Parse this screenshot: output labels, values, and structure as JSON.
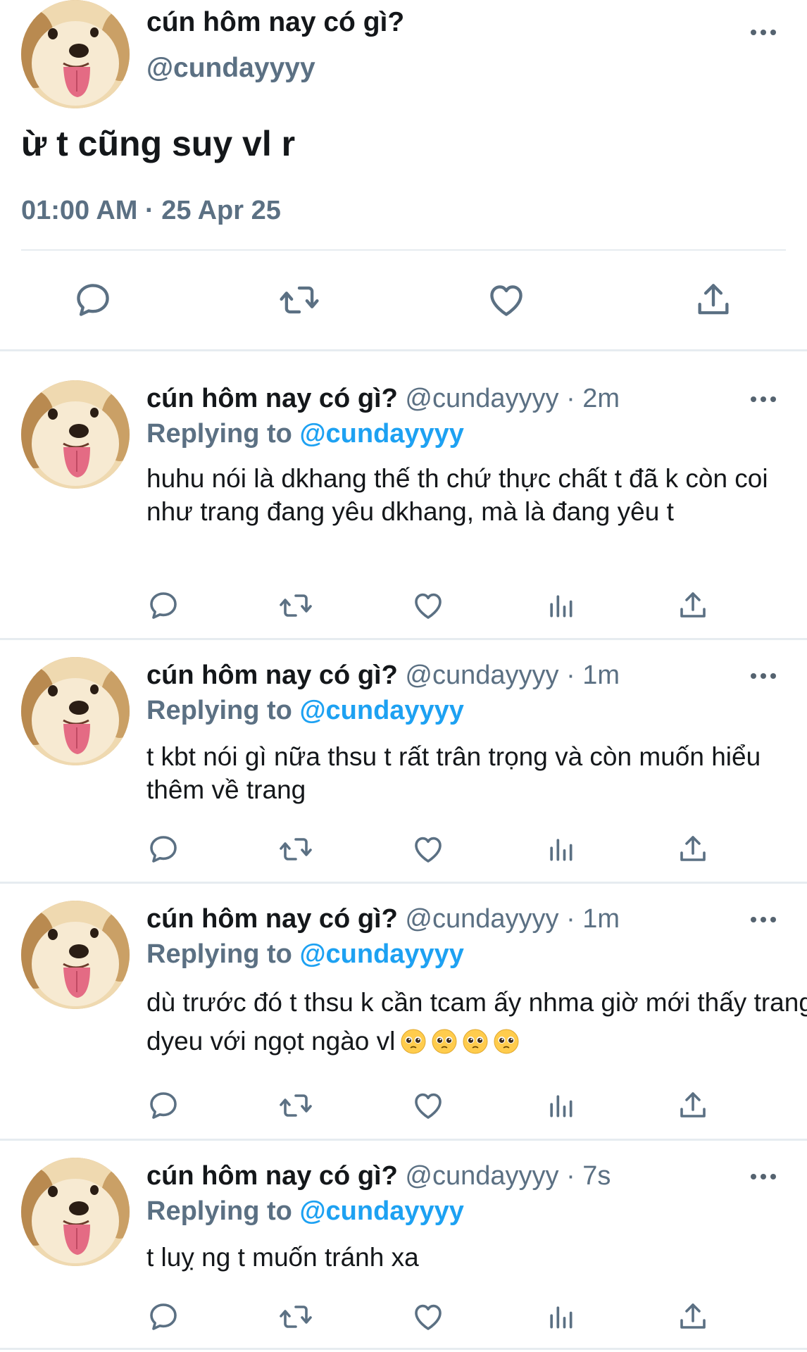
{
  "main_tweet": {
    "display_name": "cún hôm nay có gì?",
    "handle": "@cundayyyy",
    "text": "ừ t cũng suy vl r",
    "timestamp": "01:00 AM · 25 Apr 25",
    "actions": [
      "reply-icon",
      "retweet-icon",
      "like-icon",
      "share-icon"
    ]
  },
  "replies": [
    {
      "display_name": "cún hôm nay có gì?",
      "handle": "@cundayyyy",
      "time": "· 2m",
      "replying_prefix": "Replying to",
      "replying_to": "@cundayyyy",
      "text": "huhu nói là dkhang thế th chứ thực chất t đã k còn coi như trang đang yêu dkhang, mà là đang yêu t"
    },
    {
      "display_name": "cún hôm nay có gì?",
      "handle": "@cundayyyy",
      "time": "· 1m",
      "replying_prefix": "Replying to",
      "replying_to": "@cundayyyy",
      "text": "t kbt nói gì nữa thsu t rất trân trọng và còn muốn hiểu thêm về trang"
    },
    {
      "display_name": "cún hôm nay có gì?",
      "handle": "@cundayyyy",
      "time": "· 1m",
      "replying_prefix": "Replying to",
      "replying_to": "@cundayyyy",
      "text": "dù trước đó t thsu k cần tcam ấy nhma giờ mới thấy trang dyeu với ngọt ngào vl",
      "emojis": [
        "pleading-face-emoji",
        "pleading-face-emoji",
        "pleading-face-emoji",
        "pleading-face-emoji"
      ]
    },
    {
      "display_name": "cún hôm nay có gì?",
      "handle": "@cundayyyy",
      "time": "· 7s",
      "replying_prefix": "Replying to",
      "replying_to": "@cundayyyy",
      "text": "t luỵ ng t muốn tránh xa"
    }
  ],
  "colors": {
    "text": "#14171a",
    "secondary": "#5b7083",
    "link": "#1da1f2",
    "divider": "#e6ecf0"
  }
}
